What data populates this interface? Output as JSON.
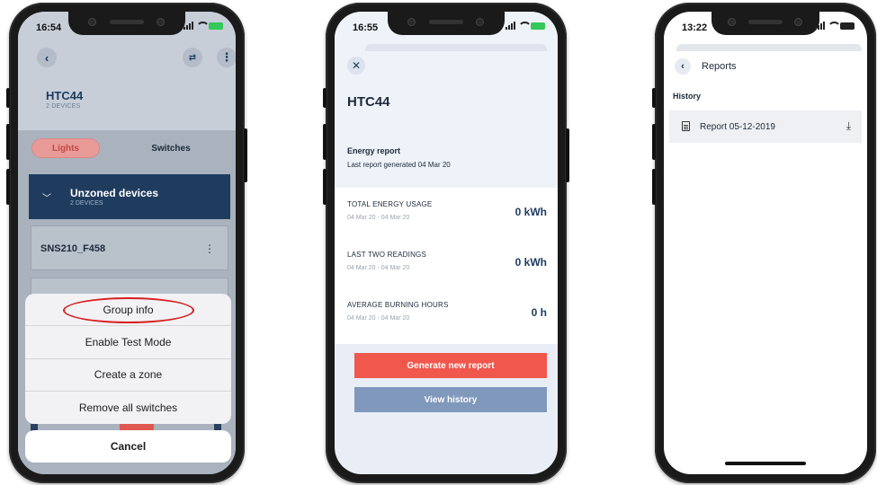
{
  "phone1": {
    "status_time": "16:54",
    "title": "HTC44",
    "subtitle": "2 DEVICES",
    "tabs": {
      "lights": "Lights",
      "switches": "Switches"
    },
    "zone": {
      "title": "Unzoned devices",
      "subtitle": "2 DEVICES"
    },
    "device_name": "SNS210_F458",
    "sheet_options": [
      "Group info",
      "Enable Test Mode",
      "Create a zone",
      "Remove all switches"
    ],
    "cancel_label": "Cancel",
    "highlight_color": "#d81e1e"
  },
  "phone2": {
    "status_time": "16:55",
    "title": "HTC44",
    "energy_report_label": "Energy report",
    "last_report": "Last report generated 04 Mar 20",
    "stats": [
      {
        "label": "TOTAL ENERGY USAGE",
        "dates": "04 Mar 20 - 04 Mar 20",
        "value": "0 kWh"
      },
      {
        "label": "LAST TWO READINGS",
        "dates": "04 Mar 20 - 04 Mar 20",
        "value": "0 kWh"
      },
      {
        "label": "AVERAGE BURNING HOURS",
        "dates": "04 Mar 20 - 04 Mar 20",
        "value": "0 h"
      }
    ],
    "generate_label": "Generate new report",
    "history_label": "View history",
    "accent_red": "#f0574d",
    "accent_blue": "#7f98bc"
  },
  "phone3": {
    "status_time": "13:22",
    "title": "Reports",
    "section": "History",
    "report_label": "Report 05-12-2019"
  }
}
